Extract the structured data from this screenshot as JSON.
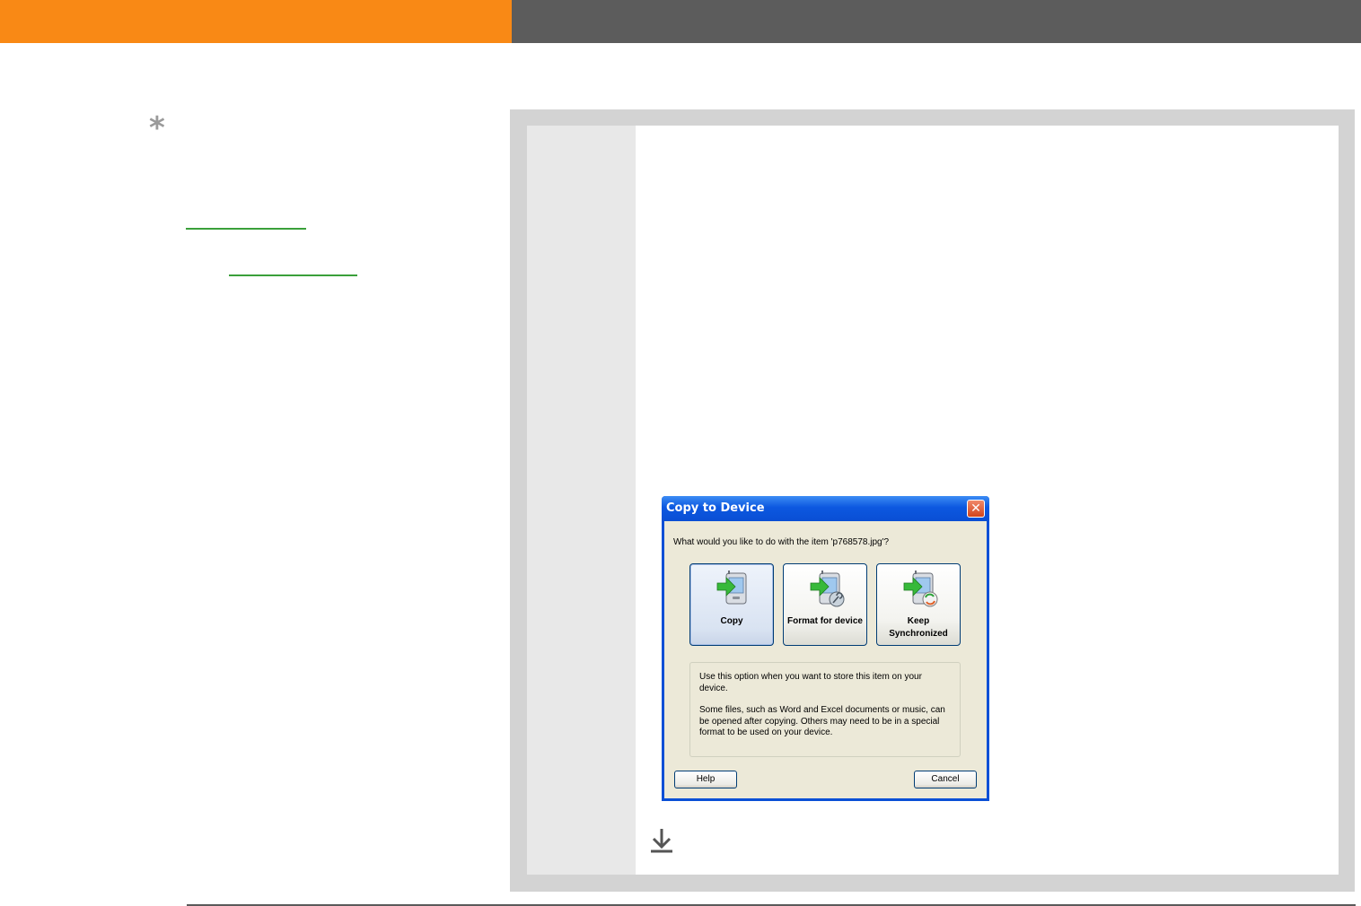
{
  "tip": {
    "icon": "asterisk-tip-icon"
  },
  "dialog": {
    "title": "Copy to Device",
    "close_icon": "close-icon",
    "prompt": "What would you like to do with the item 'p768578.jpg'?",
    "options": [
      {
        "label": "Copy",
        "icon": "device-copy-icon",
        "selected": true
      },
      {
        "label": "Format for device",
        "icon": "device-format-icon",
        "selected": false
      },
      {
        "label": "Keep Synchronized",
        "icon": "device-sync-icon",
        "selected": false
      }
    ],
    "description": [
      "Use this option when you want to store this item on your device.",
      "Some files, such as Word and Excel documents or music, can be opened after copying. Others may need to be in a special format to be used on your device."
    ],
    "help_label": "Help",
    "cancel_label": "Cancel"
  },
  "continue_icon": "arrow-down-icon",
  "colors": {
    "topbar_orange": "#f98915",
    "topbar_gray": "#5c5c5c",
    "panel_border": "#d3d3d3",
    "step_column": "#e8e8e8",
    "link_green": "#3aa03a",
    "dialog_blue": "#0a4fd6"
  }
}
